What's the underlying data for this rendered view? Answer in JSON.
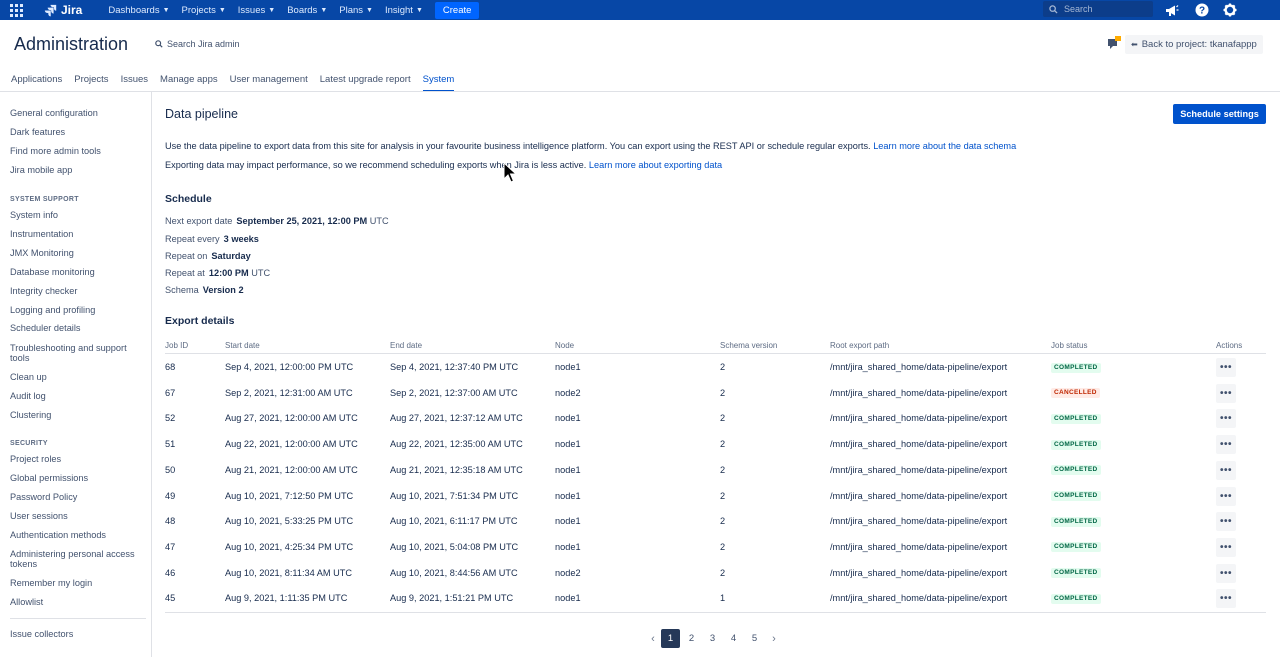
{
  "topnav": {
    "logo": "Jira",
    "items": [
      {
        "label": "Dashboards"
      },
      {
        "label": "Projects"
      },
      {
        "label": "Issues"
      },
      {
        "label": "Boards"
      },
      {
        "label": "Plans"
      },
      {
        "label": "Insight"
      }
    ],
    "create_label": "Create",
    "search_placeholder": "Search"
  },
  "header": {
    "title": "Administration",
    "search_label": "Search Jira admin",
    "back_label": "Back to project: tkanafappp"
  },
  "tabs": [
    {
      "label": "Applications"
    },
    {
      "label": "Projects"
    },
    {
      "label": "Issues"
    },
    {
      "label": "Manage apps"
    },
    {
      "label": "User management"
    },
    {
      "label": "Latest upgrade report"
    },
    {
      "label": "System",
      "active": true
    }
  ],
  "sidebar": {
    "group1": [
      "General configuration",
      "Dark features",
      "Find more admin tools",
      "Jira mobile app"
    ],
    "system_support_heading": "SYSTEM SUPPORT",
    "group2": [
      "System info",
      "Instrumentation",
      "JMX Monitoring",
      "Database monitoring",
      "Integrity checker",
      "Logging and profiling",
      "Scheduler details",
      "Troubleshooting and support tools",
      "Clean up",
      "Audit log",
      "Clustering"
    ],
    "security_heading": "SECURITY",
    "group3": [
      "Project roles",
      "Global permissions",
      "Password Policy",
      "User sessions",
      "Authentication methods",
      "Administering personal access tokens",
      "Remember my login",
      "Allowlist"
    ],
    "group4": [
      "Issue collectors"
    ]
  },
  "main": {
    "title": "Data pipeline",
    "schedule_settings_label": "Schedule settings",
    "para1": "Use the data pipeline to export data from this site for analysis in your favourite business intelligence platform. You can export using the REST API or schedule regular exports.",
    "para1_link": "Learn more about the data schema",
    "para2": "Exporting data may impact performance, so we recommend scheduling exports when Jira is less active.",
    "para2_link": "Learn more about exporting data",
    "schedule_heading": "Schedule",
    "schedule": {
      "next_export_label": "Next export date",
      "next_export_value": "September 25, 2021, 12:00 PM",
      "next_export_suffix": "UTC",
      "repeat_every_label": "Repeat every",
      "repeat_every_value": "3 weeks",
      "repeat_on_label": "Repeat on",
      "repeat_on_value": "Saturday",
      "repeat_at_label": "Repeat at",
      "repeat_at_value": "12:00 PM",
      "repeat_at_suffix": "UTC",
      "schema_label": "Schema",
      "schema_value": "Version 2"
    },
    "export_heading": "Export details",
    "columns": [
      "Job ID",
      "Start date",
      "End date",
      "Node",
      "Schema version",
      "Root export path",
      "Job status",
      "Actions"
    ],
    "rows": [
      {
        "id": "68",
        "start": "Sep 4, 2021, 12:00:00 PM UTC",
        "end": "Sep 4, 2021, 12:37:40 PM UTC",
        "node": "node1",
        "schema": "2",
        "path": "/mnt/jira_shared_home/data-pipeline/export",
        "status": "COMPLETED"
      },
      {
        "id": "67",
        "start": "Sep 2, 2021, 12:31:00 AM UTC",
        "end": "Sep 2, 2021, 12:37:00 AM UTC",
        "node": "node2",
        "schema": "2",
        "path": "/mnt/jira_shared_home/data-pipeline/export",
        "status": "CANCELLED"
      },
      {
        "id": "52",
        "start": "Aug 27, 2021, 12:00:00 AM UTC",
        "end": "Aug 27, 2021, 12:37:12 AM UTC",
        "node": "node1",
        "schema": "2",
        "path": "/mnt/jira_shared_home/data-pipeline/export",
        "status": "COMPLETED"
      },
      {
        "id": "51",
        "start": "Aug 22, 2021, 12:00:00 AM UTC",
        "end": "Aug 22, 2021, 12:35:00 AM UTC",
        "node": "node1",
        "schema": "2",
        "path": "/mnt/jira_shared_home/data-pipeline/export",
        "status": "COMPLETED"
      },
      {
        "id": "50",
        "start": "Aug 21, 2021, 12:00:00 AM UTC",
        "end": "Aug 21, 2021, 12:35:18 AM UTC",
        "node": "node1",
        "schema": "2",
        "path": "/mnt/jira_shared_home/data-pipeline/export",
        "status": "COMPLETED"
      },
      {
        "id": "49",
        "start": "Aug 10, 2021, 7:12:50 PM UTC",
        "end": "Aug 10, 2021, 7:51:34 PM UTC",
        "node": "node1",
        "schema": "2",
        "path": "/mnt/jira_shared_home/data-pipeline/export",
        "status": "COMPLETED"
      },
      {
        "id": "48",
        "start": "Aug 10, 2021, 5:33:25 PM UTC",
        "end": "Aug 10, 2021, 6:11:17 PM UTC",
        "node": "node1",
        "schema": "2",
        "path": "/mnt/jira_shared_home/data-pipeline/export",
        "status": "COMPLETED"
      },
      {
        "id": "47",
        "start": "Aug 10, 2021, 4:25:34 PM UTC",
        "end": "Aug 10, 2021, 5:04:08 PM UTC",
        "node": "node1",
        "schema": "2",
        "path": "/mnt/jira_shared_home/data-pipeline/export",
        "status": "COMPLETED"
      },
      {
        "id": "46",
        "start": "Aug 10, 2021, 8:11:34 AM UTC",
        "end": "Aug 10, 2021, 8:44:56 AM UTC",
        "node": "node2",
        "schema": "2",
        "path": "/mnt/jira_shared_home/data-pipeline/export",
        "status": "COMPLETED"
      },
      {
        "id": "45",
        "start": "Aug 9, 2021, 1:11:35 PM UTC",
        "end": "Aug 9, 2021, 1:51:21 PM UTC",
        "node": "node1",
        "schema": "1",
        "path": "/mnt/jira_shared_home/data-pipeline/export",
        "status": "COMPLETED"
      }
    ],
    "more_label": "•••",
    "pagination": {
      "pages": [
        "1",
        "2",
        "3",
        "4",
        "5"
      ],
      "current": "1"
    }
  },
  "colors": {
    "nav_bg": "#0747a6",
    "primary": "#0052cc",
    "completed_bg": "#e3fcef",
    "completed_text": "#006644",
    "cancelled_bg": "#ffebe6",
    "cancelled_text": "#bf2600"
  },
  "icons": {
    "app_switcher": "app-switcher-icon",
    "logo": "jira-logo-icon",
    "search": "search-icon",
    "notifications": "megaphone-icon",
    "help": "help-icon",
    "settings": "gear-icon",
    "feedback": "feedback-icon",
    "back": "back-arrow-icon",
    "prev": "chevron-left-icon",
    "next": "chevron-right-icon"
  }
}
